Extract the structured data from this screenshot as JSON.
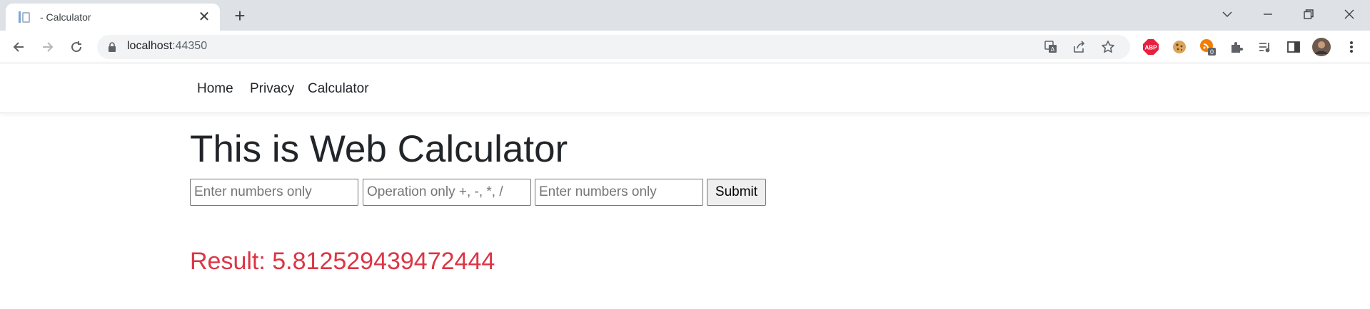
{
  "browser": {
    "tab": {
      "title": "- Calculator",
      "close_glyph": "✕",
      "favicon": "document-icon"
    },
    "new_tab_glyph": "+",
    "url": {
      "host": "localhost",
      "port": ":44350"
    },
    "extensions": {
      "adblock_label": "ABP",
      "adblock_color": "#e8203f",
      "badge_count": "0",
      "accent_orange": "#f57c00"
    }
  },
  "site": {
    "nav": {
      "home": "Home",
      "privacy": "Privacy",
      "calculator": "Calculator"
    }
  },
  "main": {
    "title": "This is Web Calculator",
    "form": {
      "num1_placeholder": "Enter numbers only",
      "op_placeholder": "Operation only +, -, *, /",
      "num2_placeholder": "Enter numbers only",
      "submit_label": "Submit"
    },
    "result_text": "Result: 5.812529439472444",
    "result_color": "#dc3545"
  }
}
